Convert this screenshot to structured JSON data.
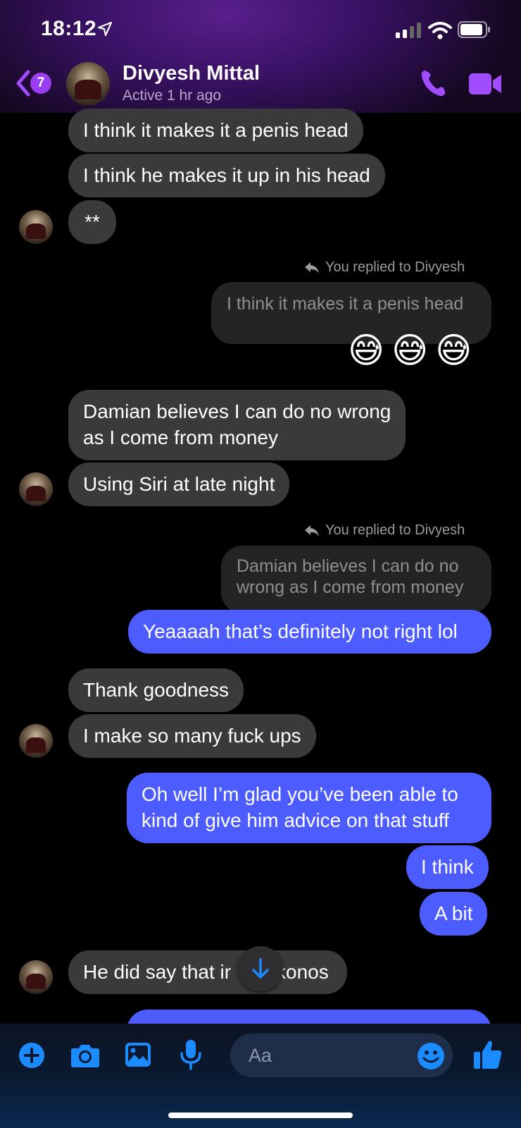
{
  "status_bar": {
    "time": "18:12"
  },
  "header": {
    "back_badge": "7",
    "contact_name": "Divyesh Mittal",
    "contact_status": "Active 1 hr ago"
  },
  "messages": {
    "m1": "I think it makes it a penis head",
    "m2": "I think he makes it up in his head",
    "m3": "**",
    "reply1_label": "You replied to Divyesh",
    "reply1_quote": "I think it makes it a penis head",
    "reply1_emoji": "😅😅😅",
    "m4_line1": "Damian believes I can do no wrong",
    "m4_line2": "as I come from money",
    "m5": "Using Siri at late night",
    "reply2_label": "You replied to Divyesh",
    "reply2_quote_line1": "Damian believes I can do no",
    "reply2_quote_line2": "wrong as I come from money",
    "reply2_text": "Yeaaaah that’s definitely not right lol",
    "m6": "Thank goodness",
    "m7": "I make so many fuck ups",
    "m8_line1": "Oh well I’m glad you’ve been able to",
    "m8_line2": "kind of give him advice on that stuff",
    "m9": "I think",
    "m10": "A bit",
    "m11_part1": "He did say that ir",
    "m11_part2": "konos"
  },
  "composer": {
    "placeholder": "Aa"
  },
  "colors": {
    "accent_purple": "#a24cff",
    "outgoing_bubble": "#4c5cff",
    "incoming_bubble": "#3a3a3c",
    "toolbar_blue": "#1a8cff"
  },
  "icons": {
    "back": "chevron-left-icon",
    "call": "phone-icon",
    "video": "video-camera-icon",
    "reply": "reply-arrow-icon",
    "add": "plus-circle-icon",
    "camera": "camera-icon",
    "gallery": "photo-icon",
    "mic": "microphone-icon",
    "emoji": "smiley-icon",
    "like": "thumbs-up-icon",
    "scroll": "arrow-down-icon"
  }
}
